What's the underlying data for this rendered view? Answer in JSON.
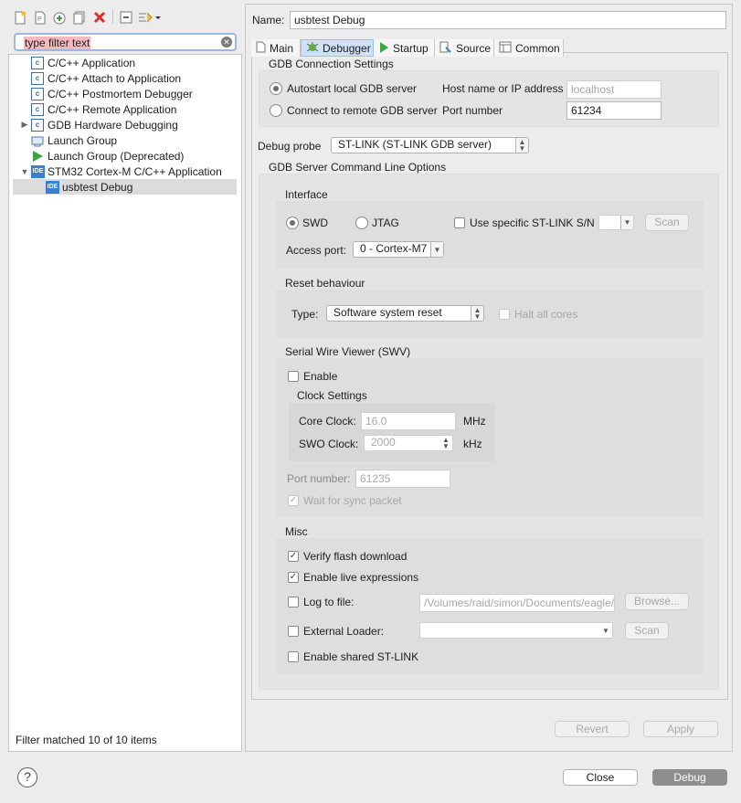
{
  "toolbar": {
    "new_icon": "new-configuration-icon",
    "new_prototype_icon": "new-prototype-icon",
    "export_icon": "export-icon",
    "duplicate_icon": "duplicate-icon",
    "delete_icon": "delete-icon",
    "collapse_icon": "collapse-all-icon",
    "filter_menu_icon": "filter-menu-icon"
  },
  "filter": {
    "placeholder": "type filter text"
  },
  "tree": {
    "items": [
      {
        "label": "C/C++ Application",
        "icon": "c-icon"
      },
      {
        "label": "C/C++ Attach to Application",
        "icon": "c-icon"
      },
      {
        "label": "C/C++ Postmortem Debugger",
        "icon": "c-icon"
      },
      {
        "label": "C/C++ Remote Application",
        "icon": "c-icon"
      },
      {
        "label": "GDB Hardware Debugging",
        "icon": "c-icon"
      },
      {
        "label": "Launch Group",
        "icon": "launch-group-icon"
      },
      {
        "label": "Launch Group (Deprecated)",
        "icon": "launch-arrow-icon"
      },
      {
        "label": "STM32 Cortex-M C/C++ Application",
        "icon": "ide-icon"
      },
      {
        "label": "usbtest Debug",
        "icon": "ide-icon"
      }
    ],
    "ide_glyph": "IDE",
    "c_glyph": "c",
    "status": "Filter matched 10 of 10 items"
  },
  "name": {
    "label": "Name:",
    "value": "usbtest Debug"
  },
  "tabs": [
    {
      "label": "Main",
      "icon": "main-tab-icon"
    },
    {
      "label": "Debugger",
      "icon": "debugger-tab-icon"
    },
    {
      "label": "Startup",
      "icon": "startup-tab-icon"
    },
    {
      "label": "Source",
      "icon": "source-tab-icon"
    },
    {
      "label": "Common",
      "icon": "common-tab-icon"
    }
  ],
  "gdb": {
    "title": "GDB Connection Settings",
    "autostart_label": "Autostart local GDB server",
    "connect_label": "Connect to remote GDB server",
    "host_label": "Host name or IP address",
    "host_value": "localhost",
    "port_label": "Port number",
    "port_value": "61234"
  },
  "probe": {
    "label": "Debug probe",
    "value": "ST-LINK (ST-LINK GDB server)"
  },
  "server": {
    "title": "GDB Server Command Line Options",
    "interface": {
      "title": "Interface",
      "swd": "SWD",
      "jtag": "JTAG",
      "specific_label": "Use specific ST-LINK S/N",
      "scan": "Scan",
      "access_label": "Access port:",
      "access_value": "0 - Cortex-M7"
    },
    "reset": {
      "title": "Reset behaviour",
      "type_label": "Type:",
      "type_value": "Software system reset",
      "halt_label": "Halt all cores"
    },
    "swv": {
      "title": "Serial Wire Viewer (SWV)",
      "enable_label": "Enable",
      "clock_title": "Clock Settings",
      "core_label": "Core Clock:",
      "core_value": "16.0",
      "core_unit": "MHz",
      "swo_label": "SWO Clock:",
      "swo_value": "2000",
      "swo_unit": "kHz",
      "port_label": "Port number:",
      "port_value": "61235",
      "wait_label": "Wait for sync packet"
    },
    "misc": {
      "title": "Misc",
      "verify_label": "Verify flash download",
      "live_label": "Enable live expressions",
      "log_label": "Log to file:",
      "log_value": "/Volumes/raid/simon/Documents/eagle/",
      "browse": "Browse...",
      "loader_label": "External Loader:",
      "loader_scan": "Scan",
      "shared_label": "Enable shared ST-LINK"
    }
  },
  "footer": {
    "revert": "Revert",
    "apply": "Apply",
    "close": "Close",
    "debug": "Debug",
    "help_icon": "help-icon"
  }
}
